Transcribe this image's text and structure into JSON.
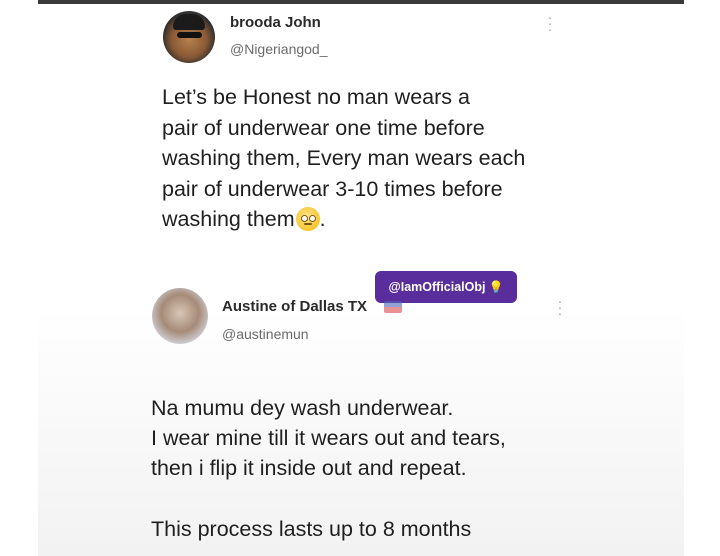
{
  "tweet1": {
    "name": "brooda John",
    "handle": "@Nigeriangod_",
    "text": "Let’s be Honest no man wears a\npair of underwear one time before\nwashing them, Every man wears each\npair of underwear 3-10 times before\nwashing them",
    "text_end": ".",
    "emoji": "rolling-eyes-emoji"
  },
  "badge": {
    "label": "@IamOfficialObj",
    "icon": "lightbulb-icon"
  },
  "tweet2": {
    "name": "Austine of Dallas TX",
    "handle": "@austinemun",
    "text": "Na mumu dey wash underwear.\nI wear mine till it wears out and tears,\nthen i flip it inside out and repeat.",
    "text2": "This process lasts up to 8 months"
  },
  "colors": {
    "badge": "#5a2d9c",
    "text": "#1f1f1f",
    "handle": "#6b6b6b"
  }
}
